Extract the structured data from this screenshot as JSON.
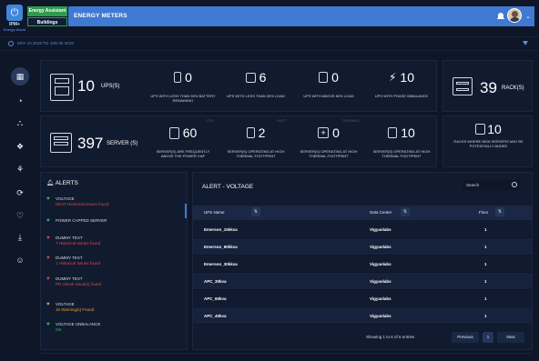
{
  "header": {
    "brand": "IPM+",
    "tagline": "Energy Assist",
    "tab_primary": "Energy Assistant",
    "tab_secondary": "Buildings",
    "title": "ENERGY METERS",
    "menu_chevron": "⌄"
  },
  "date_range": "MAY 10 2019 TO JUN 05 2019",
  "sidebar": {
    "items": [
      {
        "name": "dashboard-icon",
        "glyph": "▦"
      },
      {
        "name": "pie-chart-icon",
        "glyph": "◔"
      },
      {
        "name": "hierarchy-icon",
        "glyph": "⛬"
      },
      {
        "name": "cubes-icon",
        "glyph": "❖"
      },
      {
        "name": "network-icon",
        "glyph": "⚘"
      },
      {
        "name": "sync-icon",
        "glyph": "⟳"
      },
      {
        "name": "heartbeat-icon",
        "glyph": "♡"
      },
      {
        "name": "download-icon",
        "glyph": "⤓"
      },
      {
        "name": "user-icon",
        "glyph": "☺"
      }
    ]
  },
  "kpis": {
    "ups": {
      "value": "10",
      "label": "UPS(S)"
    },
    "ups_battery": {
      "value": "0",
      "label": "UPS WITH LESS THAN 50% BATTERY REMAINING"
    },
    "ups_low_load": {
      "value": "6",
      "label": "UPS WITH LESS THAN 30% LOAD"
    },
    "ups_high_load": {
      "value": "0",
      "label": "UPS WITH ABOVE 80% LOAD"
    },
    "ups_phase": {
      "value": "10",
      "label": "UPS WITH PHASE IMBALANCE"
    },
    "racks": {
      "value": "39",
      "label": "RACK(S)"
    },
    "servers": {
      "value": "397",
      "label": "SERVER (S)"
    },
    "srv_power_cap": {
      "value": "60",
      "label": "SERVER(S) ARE FREQUENTLY ABOVE THE POWER CAP",
      "tag": "CPU"
    },
    "srv_thermal1": {
      "value": "2",
      "label": "SERVER(S) OPERATING AT HIGH THERMAL FOOTPRINT",
      "tag": "INLET"
    },
    "srv_thermal2": {
      "value": "0",
      "label": "SERVER(S) OPERATING AT HIGH THERMAL FOOTPRINT",
      "tag": "THERMAL"
    },
    "srv_thermal3": {
      "value": "10",
      "label": "SERVER(S) OPERATING AT HIGH THERMAL FOOTPRINT"
    },
    "racks_added": {
      "value": "10",
      "label": "RACKS WHERE NEW SERVERS MAY BE POTENTIALLY ADDED"
    }
  },
  "alerts": {
    "title": "ALERTS",
    "items": [
      {
        "title": "VOLTAGE",
        "sub": "NEXT Historical Issues found",
        "heart": "#3fbf5a",
        "subcolor": "#e04848"
      },
      {
        "title": "POWER CAPPED SERVER",
        "sub": "",
        "heart": "#3fbf5a",
        "subcolor": "#e04848"
      },
      {
        "title": "DUMMY TEXT",
        "sub": "7 Historical Issues found",
        "heart": "#e04848",
        "subcolor": "#e04848"
      },
      {
        "title": "DUMMY TEXT",
        "sub": "1 Historical Issues found",
        "heart": "#e04848",
        "subcolor": "#e04848"
      },
      {
        "title": "DUMMY TEXT",
        "sub": "PR critical Issue(s) found",
        "heart": "#e04848",
        "subcolor": "#e04848"
      },
      {
        "title": "VOLTAGE",
        "sub": "15 Warning(s) Found",
        "heart": "#e8a030",
        "subcolor": "#e8a030"
      },
      {
        "title": "VOLTAGE UNBALANCE",
        "sub": "OK",
        "heart": "#3fbf5a",
        "subcolor": "#3fbf5a"
      }
    ]
  },
  "table": {
    "title": "ALERT - VOLTAGE",
    "search_placeholder": "Search",
    "columns": [
      "UPS Name",
      "Data Center",
      "Floor"
    ],
    "sort_glyph": "⇅",
    "rows": [
      [
        "Emerson_15kkva",
        "Vigyanlabs",
        "1"
      ],
      [
        "Emerson_60kkva",
        "Vigyanlabs",
        "1"
      ],
      [
        "Emerson_30kkva",
        "Vigyanlabs",
        "1"
      ],
      [
        "APC_30kva",
        "Vigyanlabs",
        "1"
      ],
      [
        "APC_60kva",
        "Vigyanlabs",
        "1"
      ],
      [
        "APC_40kva",
        "Vigyanlabs",
        "1"
      ]
    ],
    "info": "Showing 1 to 6 of 6 entries",
    "prev": "Previous",
    "page": "1",
    "next": "Next"
  },
  "colors": {
    "accent": "#3f79d2",
    "ok": "#2e9c4c",
    "bg": "#0e1628",
    "card": "#111b30"
  }
}
